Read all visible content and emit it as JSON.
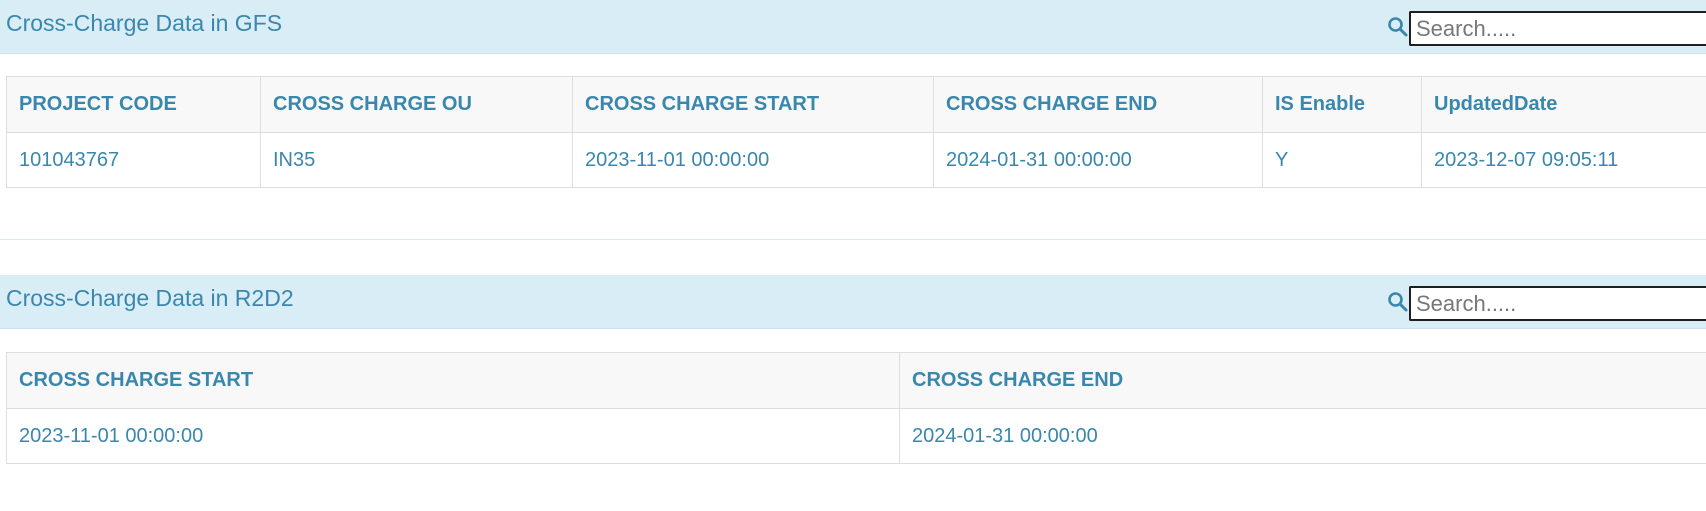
{
  "colors": {
    "header_bg": "#d9edf7",
    "accent_text": "#3a87ad",
    "table_header_bg": "#f8f8f8",
    "border": "#dddddd"
  },
  "gfs_panel": {
    "title": "Cross-Charge Data in GFS",
    "search": {
      "placeholder": "Search.....",
      "value": "",
      "icon": "search-icon"
    },
    "table": {
      "columns": [
        "PROJECT CODE",
        "CROSS CHARGE OU",
        "CROSS CHARGE START",
        "CROSS CHARGE END",
        "IS Enable",
        "UpdatedDate"
      ],
      "rows": [
        [
          "101043767",
          "IN35",
          "2023-11-01 00:00:00",
          "2024-01-31 00:00:00",
          "Y",
          "2023-12-07 09:05:11"
        ]
      ]
    }
  },
  "r2d2_panel": {
    "title": "Cross-Charge Data in R2D2",
    "search": {
      "placeholder": "Search.....",
      "value": "",
      "icon": "search-icon"
    },
    "table": {
      "columns": [
        "CROSS CHARGE START",
        "CROSS CHARGE END"
      ],
      "rows": [
        [
          "2023-11-01 00:00:00",
          "2024-01-31 00:00:00"
        ]
      ]
    }
  }
}
